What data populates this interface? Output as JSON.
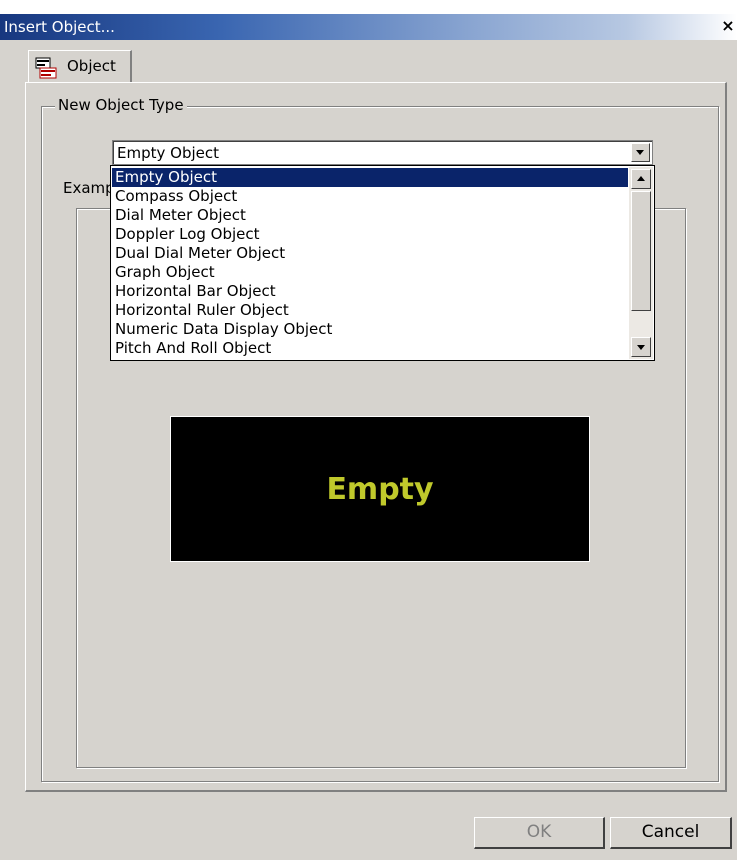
{
  "window": {
    "title": "Insert Object...",
    "close_label": "×"
  },
  "tabs": [
    {
      "label": "Object",
      "icon": "object-tab-icon"
    }
  ],
  "group": {
    "label": "New Object Type",
    "example_label": "Examp"
  },
  "combo": {
    "value": "Empty Object"
  },
  "dropdown": {
    "items": [
      "Empty Object",
      "Compass Object",
      "Dial Meter Object",
      "Doppler Log Object",
      "Dual Dial Meter Object",
      "Graph Object",
      "Horizontal Bar Object",
      "Horizontal Ruler Object",
      "Numeric Data Display Object",
      "Pitch And Roll Object"
    ],
    "selected_index": 0
  },
  "preview": {
    "text": "Empty",
    "text_color": "#c0c92b",
    "background": "#000000"
  },
  "buttons": {
    "ok_label": "OK",
    "cancel_label": "Cancel"
  },
  "colors": {
    "selection": "#0a246a",
    "dialog_bg": "#d6d3ce"
  }
}
